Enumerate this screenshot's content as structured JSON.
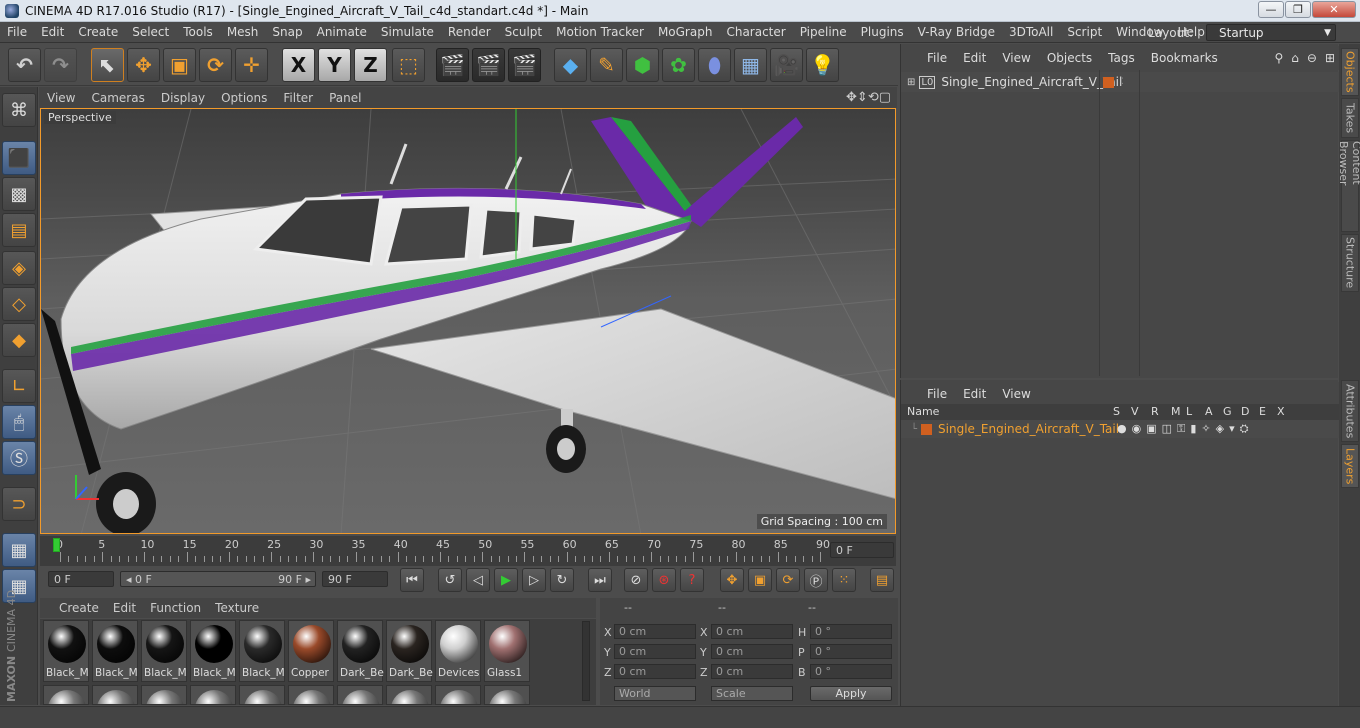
{
  "window": {
    "title": "CINEMA 4D R17.016 Studio (R17) - [Single_Engined_Aircraft_V_Tail_c4d_standart.c4d *] - Main",
    "controls": {
      "minimize": "—",
      "maximize": "❐",
      "close": "✕"
    }
  },
  "menubar": {
    "items": [
      "File",
      "Edit",
      "Create",
      "Select",
      "Tools",
      "Mesh",
      "Snap",
      "Animate",
      "Simulate",
      "Render",
      "Sculpt",
      "Motion Tracker",
      "MoGraph",
      "Character",
      "Pipeline",
      "Plugins",
      "V-Ray Bridge",
      "3DToAll",
      "Script",
      "Window",
      "Help"
    ],
    "layout_label": "Layout:",
    "layout_value": "Startup"
  },
  "toolbar": {
    "axis_x": "X",
    "axis_y": "Y",
    "axis_z": "Z"
  },
  "viewport": {
    "menu": [
      "View",
      "Cameras",
      "Display",
      "Options",
      "Filter",
      "Panel"
    ],
    "label": "Perspective",
    "grid_spacing": "Grid Spacing : 100 cm",
    "nav_icons": "✥⇕⟲▢"
  },
  "timeline": {
    "ticks": [
      "0",
      "5",
      "10",
      "15",
      "20",
      "25",
      "30",
      "35",
      "40",
      "45",
      "50",
      "55",
      "60",
      "65",
      "70",
      "75",
      "80",
      "85",
      "90"
    ],
    "current_frame": "0 F",
    "start_field": "0 F",
    "range_start": "◂ 0 F",
    "range_end": "90 F ▸",
    "end_field": "90 F"
  },
  "materials": {
    "menu": [
      "Create",
      "Edit",
      "Function",
      "Texture"
    ],
    "items": [
      {
        "name": "Black_M",
        "color": "#111111"
      },
      {
        "name": "Black_M",
        "color": "#0d0d0d"
      },
      {
        "name": "Black_M",
        "color": "#151515"
      },
      {
        "name": "Black_M",
        "color": "#000000"
      },
      {
        "name": "Black_M",
        "color": "#2a2a2a"
      },
      {
        "name": "Copper",
        "color": "#9a4a2a"
      },
      {
        "name": "Dark_Be",
        "color": "#222222"
      },
      {
        "name": "Dark_Be",
        "color": "#2a2420"
      },
      {
        "name": "Devices",
        "color": "#cfcfcf"
      },
      {
        "name": "Glass1",
        "color": "#a07070"
      }
    ]
  },
  "coords": {
    "header": [
      "--",
      "--",
      "--"
    ],
    "rows": [
      {
        "a": "X",
        "av": "0 cm",
        "b": "X",
        "bv": "0 cm",
        "c": "H",
        "cv": "0 °"
      },
      {
        "a": "Y",
        "av": "0 cm",
        "b": "Y",
        "bv": "0 cm",
        "c": "P",
        "cv": "0 °"
      },
      {
        "a": "Z",
        "av": "0 cm",
        "b": "Z",
        "bv": "0 cm",
        "c": "B",
        "cv": "0 °"
      }
    ],
    "world": "World",
    "scale": "Scale",
    "apply": "Apply"
  },
  "objects_panel": {
    "menu": [
      "File",
      "Edit",
      "View",
      "Objects",
      "Tags",
      "Bookmarks"
    ],
    "object_name": "Single_Engined_Aircraft_V_Tail",
    "object_color": "#d06020"
  },
  "layers_panel": {
    "menu": [
      "File",
      "Edit",
      "View"
    ],
    "columns": [
      "Name",
      "S",
      "V",
      "R",
      "M",
      "L",
      "A",
      "G",
      "D",
      "E",
      "X"
    ],
    "layer_name": "Single_Engined_Aircraft_V_Tail",
    "layer_color": "#f0a030"
  },
  "side_tabs": [
    "Objects",
    "Takes",
    "Content Browser",
    "Structure",
    "Attributes",
    "Layers"
  ],
  "brand": {
    "maxon": "MAXON",
    "product": "CINEMA 4D"
  }
}
